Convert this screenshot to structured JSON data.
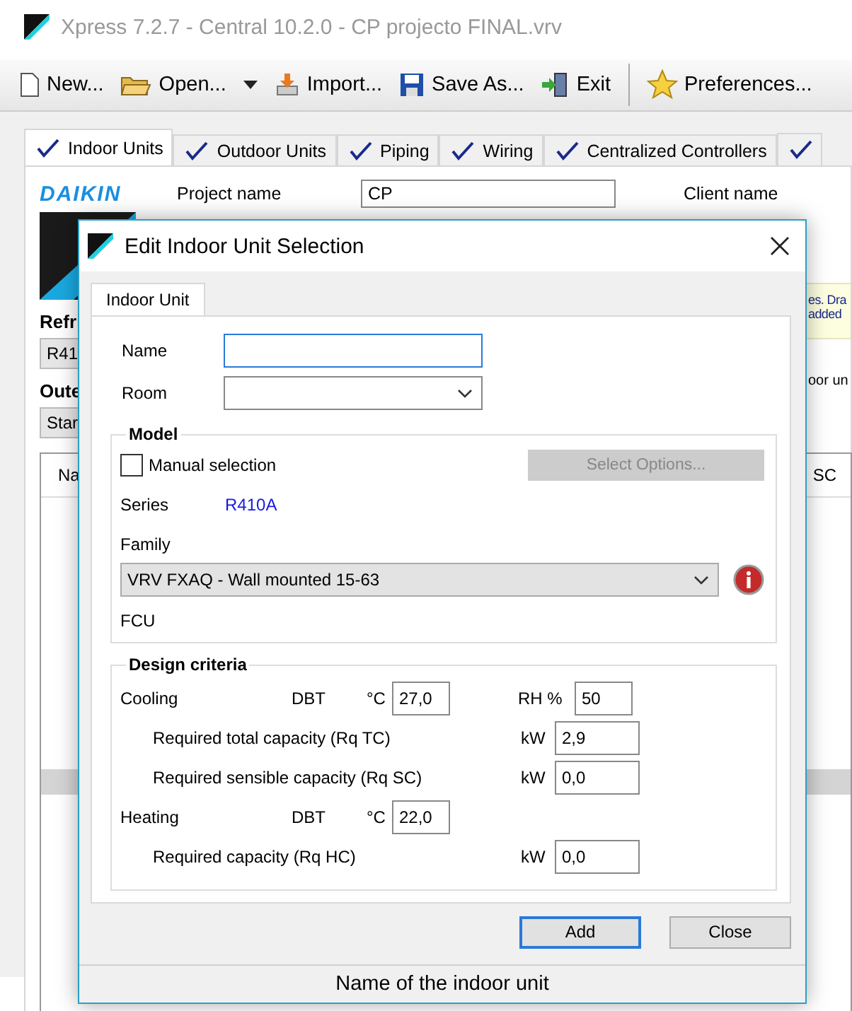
{
  "window": {
    "title": "Xpress 7.2.7 - Central 10.2.0 - CP projecto FINAL.vrv"
  },
  "toolbar": [
    {
      "label": "New...",
      "kind": "new"
    },
    {
      "label": "Open...",
      "kind": "open"
    },
    {
      "label": "Import...",
      "kind": "import"
    },
    {
      "label": "Save As...",
      "kind": "save"
    },
    {
      "label": "Exit",
      "kind": "exit"
    },
    {
      "label": "Preferences...",
      "kind": "preferences"
    }
  ],
  "tabs": [
    {
      "label": "Indoor Units",
      "selected": true
    },
    {
      "label": "Outdoor Units",
      "selected": false
    },
    {
      "label": "Piping",
      "selected": false
    },
    {
      "label": "Wiring",
      "selected": false
    },
    {
      "label": "Centralized Controllers",
      "selected": false
    }
  ],
  "project": {
    "logo": "DAIKIN",
    "project_label": "Project name",
    "project_value": "CP",
    "client_label": "Client name"
  },
  "background": {
    "refrigerant_heading": "Refr",
    "refrigerant_value": "R41",
    "outdoor_heading": "Oute",
    "outdoor_value": "Star",
    "note_lines": [
      "es. Dra",
      "added"
    ],
    "right_label": "oor un",
    "table_columns": [
      "Na",
      "SC"
    ]
  },
  "dialog": {
    "title": "Edit Indoor Unit Selection",
    "tabs": [
      {
        "label": "Indoor Unit",
        "selected": true
      }
    ],
    "name": {
      "label": "Name",
      "focused": true
    },
    "room": {
      "label": "Room"
    },
    "model": {
      "legend": "Model",
      "manual": {
        "label": "Manual selection",
        "checked": false
      },
      "options_button": {
        "label": "Select Options...",
        "disabled": true
      },
      "series_label": "Series",
      "series_value": "R410A",
      "family_label": "Family",
      "family_value": "VRV FXAQ - Wall mounted 15-63",
      "type": "FCU"
    },
    "criteria": {
      "legend": "Design criteria",
      "rows": [
        {
          "kind": "temp",
          "label": "Cooling",
          "measure": "DBT",
          "unit": "°C",
          "value": "27,0",
          "humidity_label": "RH %",
          "humidity_value": "50"
        },
        {
          "kind": "capacity",
          "label": "Required total capacity (Rq TC)",
          "unit": "kW",
          "value": "2,9"
        },
        {
          "kind": "capacity",
          "label": "Required sensible capacity (Rq SC)",
          "unit": "kW",
          "value": "0,0"
        },
        {
          "kind": "temp",
          "label": "Heating",
          "measure": "DBT",
          "unit": "°C",
          "value": "22,0"
        },
        {
          "kind": "capacity",
          "label": "Required capacity (Rq HC)",
          "unit": "kW",
          "value": "0,0"
        }
      ]
    },
    "buttons": [
      {
        "label": "Add",
        "default": true
      },
      {
        "label": "Close",
        "default": false
      }
    ],
    "status": "Name of the indoor unit"
  }
}
